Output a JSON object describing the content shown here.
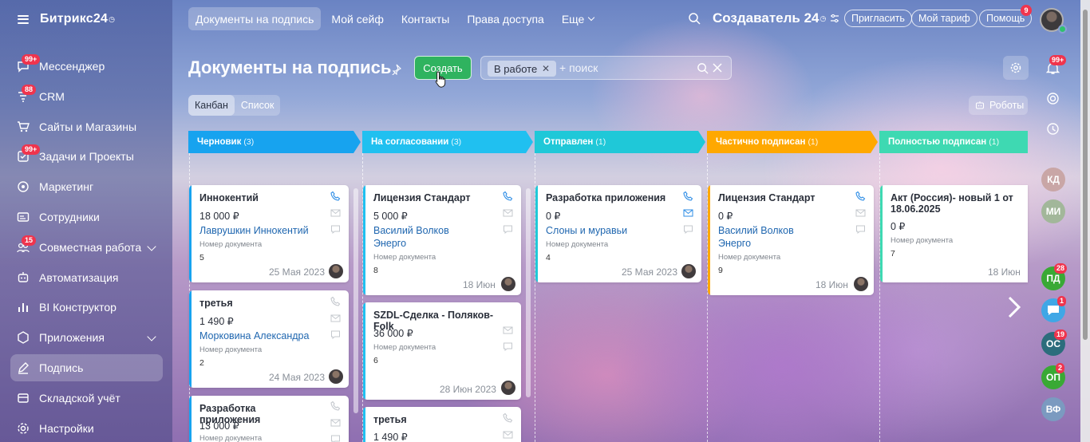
{
  "sidebar": {
    "brand": "Битрикс24",
    "items": [
      {
        "label": "Мессенджер",
        "badge": "99+",
        "icon": "messenger-icon"
      },
      {
        "label": "CRM",
        "badge": "88",
        "icon": "crm-icon"
      },
      {
        "label": "Сайты и Магазины",
        "badge": "",
        "icon": "cart-icon"
      },
      {
        "label": "Задачи и Проекты",
        "badge": "99+",
        "icon": "tasks-icon"
      },
      {
        "label": "Маркетинг",
        "badge": "",
        "icon": "marketing-icon"
      },
      {
        "label": "Сотрудники",
        "badge": "",
        "icon": "employees-icon"
      },
      {
        "label": "Совместная работа",
        "badge": "15",
        "icon": "collab-icon"
      },
      {
        "label": "Автоматизация",
        "badge": "",
        "icon": "automation-icon"
      },
      {
        "label": "BI Конструктор",
        "badge": "",
        "icon": "bi-icon"
      },
      {
        "label": "Приложения",
        "badge": "",
        "icon": "apps-icon"
      },
      {
        "label": "Подпись",
        "badge": "",
        "icon": "sign-icon"
      },
      {
        "label": "Складской учёт",
        "badge": "",
        "icon": "warehouse-icon"
      },
      {
        "label": "Настройки",
        "badge": "",
        "icon": "settings-icon"
      }
    ]
  },
  "topbar": {
    "tabs": [
      "Документы на подпись",
      "Мой сейф",
      "Контакты",
      "Права доступа",
      "Еще"
    ],
    "company": "Создаватель 24",
    "invite": "Пригласить",
    "tariff": "Мой тариф",
    "help": "Помощь",
    "help_badge": "9"
  },
  "page": {
    "title": "Документы на подпись",
    "create": "Создать",
    "filter_chip": "В работе",
    "search_placeholder": "+ поиск",
    "view_kanban": "Канбан",
    "view_list": "Список",
    "robots": "Роботы"
  },
  "columns": [
    {
      "name": "Черновик",
      "count": "(3)",
      "color": "#17a3ef"
    },
    {
      "name": "На согласовании",
      "count": "(3)",
      "color": "#20c0f0"
    },
    {
      "name": "Отправлен",
      "count": "(1)",
      "color": "#1fc8d8"
    },
    {
      "name": "Частично подписан",
      "count": "(1)",
      "color": "#ffa800"
    },
    {
      "name": "Полностью подписан",
      "count": "(1)",
      "color": "#3ed9b2"
    }
  ],
  "doc_label": "Номер документа",
  "cards": {
    "c1": {
      "title": "Иннокентий",
      "sum": "18 000 ₽",
      "client": "Лаврушкин Иннокентий",
      "doc": "5",
      "date": "25 Мая 2023"
    },
    "c2": {
      "title": "третья",
      "sum": "1 490 ₽",
      "client": "Морковина Александра",
      "doc": "2",
      "date": "24 Мая 2023"
    },
    "c3": {
      "title": "Разработка приложения",
      "sum": "13 000 ₽"
    },
    "c4": {
      "title": "Лицензия Стандарт",
      "sum": "5 000 ₽",
      "client1": "Василий Волков",
      "client2": "Энерго",
      "doc": "8",
      "date": "18 Июн"
    },
    "c5": {
      "title": "SZDL-Сделка - Поляков-Folk",
      "sum": "36 000 ₽",
      "doc": "6",
      "date": "28 Июн 2023"
    },
    "c6": {
      "title": "третья",
      "sum": "1 490 ₽"
    },
    "c7": {
      "title": "Разработка приложения",
      "sum": "0 ₽",
      "client": "Слоны и муравьи",
      "doc": "4",
      "date": "25 Мая 2023"
    },
    "c8": {
      "title": "Лицензия Стандарт",
      "sum": "0 ₽",
      "client1": "Василий Волков",
      "client2": "Энерго",
      "doc": "9",
      "date": "18 Июн"
    },
    "c9": {
      "title1": "Акт (Россия)- новый 1 от",
      "title2": "18.06.2025",
      "sum": "0 ₽",
      "doc": "7",
      "date": "18 Июн"
    }
  },
  "rail": {
    "notif_badge": "99+",
    "users": [
      {
        "initials": "КД",
        "color": "#c9a6a6",
        "badge": ""
      },
      {
        "initials": "МИ",
        "color": "#a2b79a",
        "badge": ""
      },
      {
        "initials": "ПД",
        "color": "#39a935",
        "badge": "28"
      },
      {
        "initials": "ОС",
        "color": "#2c6d7c",
        "badge": "19"
      },
      {
        "initials": "ОП",
        "color": "#39a935",
        "badge": "2"
      },
      {
        "initials": "ВФ",
        "color": "#7b9ac0",
        "badge": ""
      }
    ],
    "chat_badge": "1"
  },
  "colors": {
    "accent_green": "#2fb35f",
    "badge_red": "#f0344d",
    "link_blue": "#2067b0"
  }
}
